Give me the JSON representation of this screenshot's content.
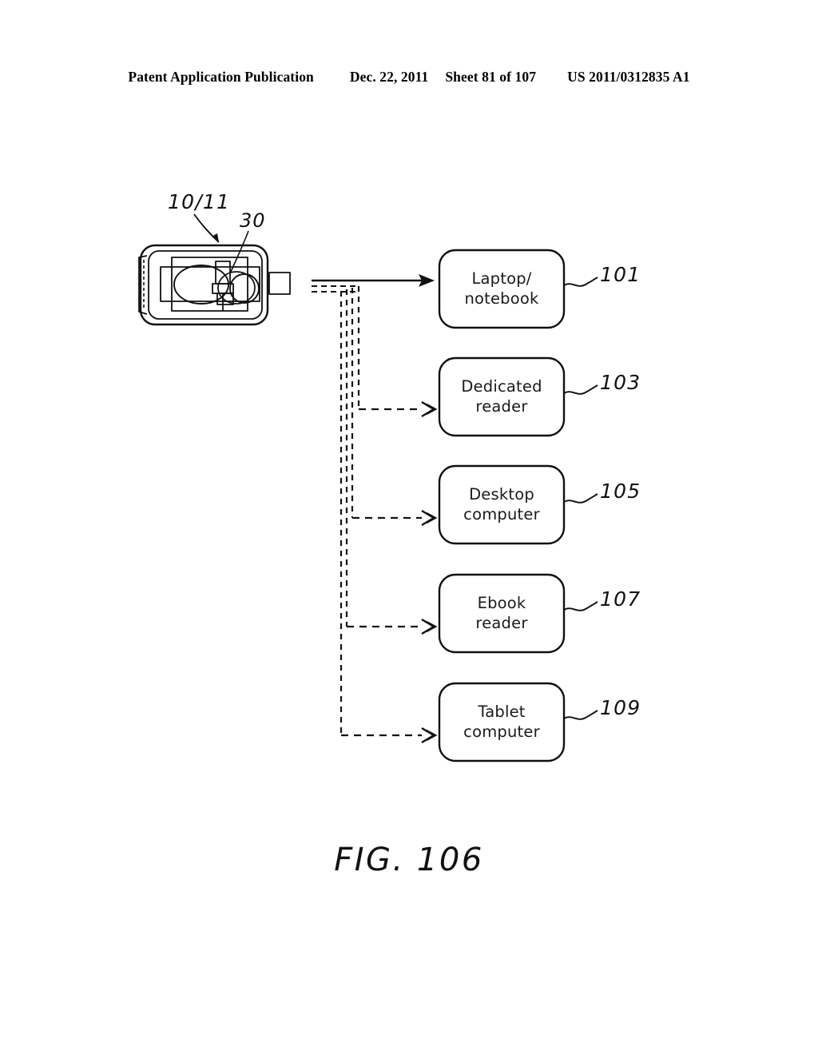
{
  "header": {
    "publication": "Patent Application Publication",
    "date": "Dec. 22, 2011",
    "sheet": "Sheet 81 of 107",
    "patent_number": "US 2011/0312835 A1"
  },
  "figure": {
    "caption": "FIG. 106",
    "source_device": {
      "label_device": "10/11",
      "label_component": "30"
    },
    "targets": [
      {
        "line1": "Laptop/",
        "line2": "notebook",
        "ref": "101",
        "arrow": "solid"
      },
      {
        "line1": "Dedicated",
        "line2": "reader",
        "ref": "103",
        "arrow": "dashed"
      },
      {
        "line1": "Desktop",
        "line2": "computer",
        "ref": "105",
        "arrow": "dashed"
      },
      {
        "line1": "Ebook",
        "line2": "reader",
        "ref": "107",
        "arrow": "dashed"
      },
      {
        "line1": "Tablet",
        "line2": "computer",
        "ref": "109",
        "arrow": "dashed"
      }
    ]
  },
  "colors": {
    "ink": "#000000",
    "paper": "#ffffff"
  }
}
